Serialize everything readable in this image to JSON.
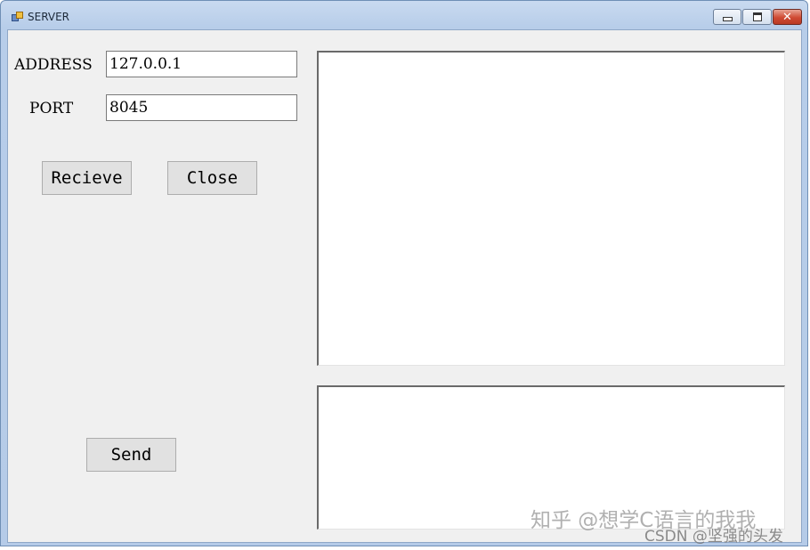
{
  "window": {
    "title": "SERVER",
    "controls": {
      "minimize": "minimize",
      "maximize": "maximize",
      "close": "✕"
    }
  },
  "form": {
    "address_label": "ADDRESS",
    "address_value": "127.0.0.1",
    "port_label": "PORT",
    "port_value": "8045",
    "receive_button": "Recieve",
    "close_button": "Close",
    "send_button": "Send",
    "receive_log_value": "",
    "send_message_value": ""
  },
  "watermark": {
    "line1": "知乎 @想学C语言的我我",
    "line2": "CSDN @坚强的头发"
  },
  "icons": {
    "app_icon": "window-app-icon",
    "minimize": "minimize-icon",
    "maximize": "maximize-icon",
    "close": "close-icon"
  },
  "colors": {
    "titlebar": "#b7cde9",
    "client_background": "#f0f0f0",
    "button_face": "#e1e1e1",
    "close_button": "#cf4a33"
  }
}
